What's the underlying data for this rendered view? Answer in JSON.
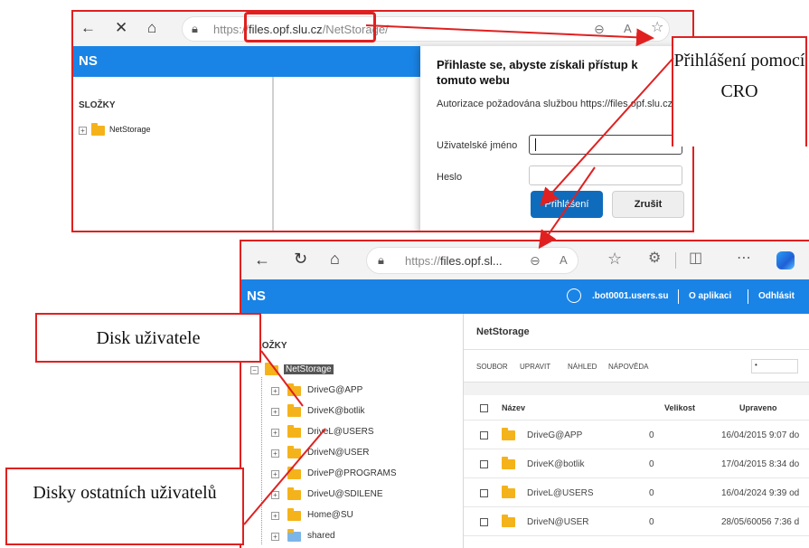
{
  "top_browser": {
    "url_scheme": "https://",
    "url_host": "files.opf.slu.cz",
    "url_path": "/NetStorage/",
    "app_logo": "NS",
    "folders_heading": "SLOŽKY",
    "tree_root": "NetStorage"
  },
  "login_dialog": {
    "title": "Přihlaste se, abyste získali přístup k tomuto webu",
    "subtitle": "Autorizace požadována službou https://files.opf.slu.cz",
    "username_label": "Uživatelské jméno",
    "password_label": "Heslo",
    "login_button": "Přihlášení",
    "cancel_button": "Zrušit"
  },
  "bottom_browser": {
    "url_scheme": "https://",
    "url_host": "files.opf.sl...",
    "app_logo": "NS",
    "user": ".bot0001.users.su",
    "about_link": "O aplikaci",
    "logout_link": "Odhlásit",
    "folders_heading": "SLOŽKY",
    "tree_root": "NetStorage",
    "tree_items": [
      "DriveG@APP",
      "DriveK@botlik",
      "DriveL@USERS",
      "DriveN@USER",
      "DriveP@PROGRAMS",
      "DriveU@SDILENE",
      "Home@SU",
      "shared"
    ],
    "pane_title": "NetStorage",
    "menu": [
      "SOUBOR",
      "UPRAVIT",
      "NÁHLED",
      "NÁPOVĚDA"
    ],
    "columns": [
      "Název",
      "Velikost",
      "Upraveno"
    ],
    "rows": [
      {
        "name": "DriveG@APP",
        "size": "0",
        "modified": "16/04/2015 9:07 do"
      },
      {
        "name": "DriveK@botlik",
        "size": "0",
        "modified": "17/04/2015 8:34 do"
      },
      {
        "name": "DriveL@USERS",
        "size": "0",
        "modified": "16/04/2024 9:39 od"
      },
      {
        "name": "DriveN@USER",
        "size": "0",
        "modified": "28/05/60056 7:36 d"
      }
    ]
  },
  "callouts": {
    "login_cro": "Přihlášení pomocí CRO",
    "user_disk": "Disk uživatele",
    "other_disks": "Disky ostatních uživatelů"
  },
  "colors": {
    "annotation_red": "#e02020",
    "brand_blue": "#1a84e6",
    "primary_button": "#0f6cbd",
    "folder_yellow": "#f5b31b"
  }
}
